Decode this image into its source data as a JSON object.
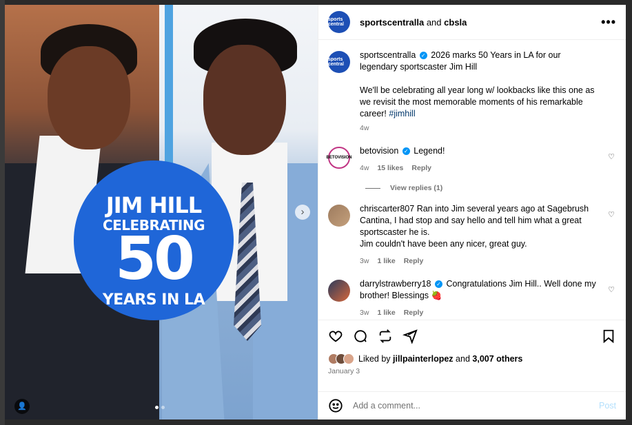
{
  "media": {
    "badge_line1": "JIM HILL",
    "badge_line2": "CELEBRATING",
    "badge_line3": "50",
    "badge_line4": "YEARS IN LA"
  },
  "header": {
    "author": "sportscentralla",
    "connector": "and",
    "collaborator": "cbsla",
    "avatar_text": "sports central",
    "more": "•••"
  },
  "caption": {
    "username": "sportscentralla",
    "text1": "2026 marks 50 Years in LA for our legendary sportscaster Jim Hill",
    "text2": "We'll be celebrating all year long w/ lookbacks like this one as we revisit the most memorable moments of his remarkable career!",
    "hashtag": "#jimhill",
    "time": "4w"
  },
  "comments": [
    {
      "username": "betovision",
      "verified": true,
      "text": "Legend!",
      "avatar_text": "BETOVISION",
      "time": "4w",
      "likes": "15 likes",
      "reply": "Reply",
      "view_replies": "View replies (1)"
    },
    {
      "username": "chriscarter807",
      "verified": false,
      "text1": "Ran into Jim several years ago at Sagebrush Cantina, I had stop and say hello and tell him what a great sportscaster he is.",
      "text2": "Jim couldn't have been any nicer, great guy.",
      "time": "3w",
      "likes": "1 like",
      "reply": "Reply"
    },
    {
      "username": "darrylstrawberry18",
      "verified": true,
      "text": "Congratulations Jim Hill.. Well done my brother! Blessings 🍓",
      "time": "3w",
      "likes": "1 like",
      "reply": "Reply"
    }
  ],
  "likes": {
    "prefix": "Liked by",
    "user": "jillpainterlopez",
    "and": "and",
    "others": "3,007 others"
  },
  "date": "January 3",
  "composer": {
    "placeholder": "Add a comment...",
    "post": "Post"
  },
  "icons": {
    "like": "heart-icon",
    "comment": "comment-icon",
    "share": "share-icon",
    "save": "bookmark-icon",
    "emoji": "emoji-icon"
  }
}
